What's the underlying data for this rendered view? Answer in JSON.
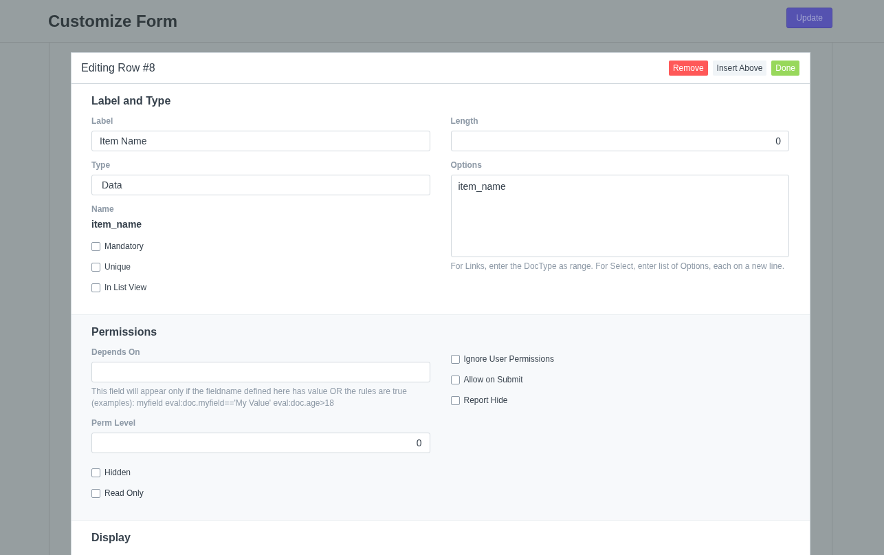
{
  "page": {
    "title": "Customize Form",
    "update_button": "Update"
  },
  "row_editor": {
    "title": "Editing Row #8",
    "actions": [
      {
        "label": "Remove",
        "kind": "danger"
      },
      {
        "label": "Insert Above",
        "kind": "default"
      },
      {
        "label": "Done",
        "kind": "success"
      }
    ]
  },
  "sections": [
    {
      "title": "Label and Type",
      "columns": [
        [
          {
            "kind": "input",
            "label": "Label",
            "value": "Item Name"
          },
          {
            "kind": "select",
            "label": "Type",
            "value": "Data"
          },
          {
            "kind": "static",
            "label": "Name",
            "value": "item_name"
          },
          {
            "kind": "checkbox",
            "label": "Mandatory",
            "checked": false
          },
          {
            "kind": "checkbox",
            "label": "Unique",
            "checked": false
          },
          {
            "kind": "checkbox",
            "label": "In List View",
            "checked": false
          }
        ],
        [
          {
            "kind": "number",
            "label": "Length",
            "value": "0"
          },
          {
            "kind": "textarea",
            "label": "Options",
            "value": "item_name",
            "help": "For Links, enter the DocType as range. For Select, enter list of Options, each on a new line."
          }
        ]
      ]
    },
    {
      "title": "Permissions",
      "columns": [
        [
          {
            "kind": "input",
            "label": "Depends On",
            "help": "This field will appear only if the fieldname defined here has value OR the rules are true (examples): myfield eval:doc.myfield=='My Value' eval:doc.age>18"
          },
          {
            "kind": "number",
            "label": "Perm Level",
            "value": "0"
          },
          {
            "kind": "checkbox",
            "label": "Hidden",
            "checked": false
          },
          {
            "kind": "checkbox",
            "label": "Read Only",
            "checked": false
          }
        ],
        [
          {
            "kind": "checkbox",
            "label": "Ignore User Permissions",
            "checked": false
          },
          {
            "kind": "checkbox",
            "label": "Allow on Submit",
            "checked": false
          },
          {
            "kind": "checkbox",
            "label": "Report Hide",
            "checked": false
          }
        ]
      ]
    },
    {
      "title": "Display"
    }
  ]
}
